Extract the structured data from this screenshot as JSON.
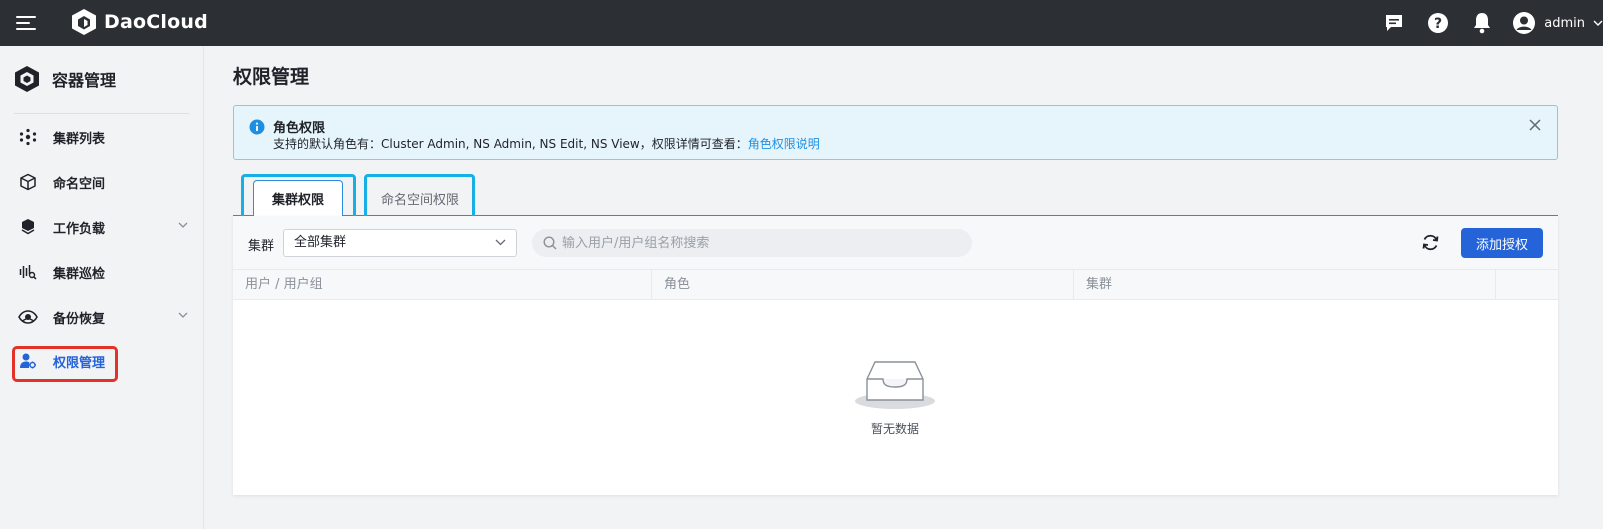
{
  "app": {
    "brand": "DaoCloud"
  },
  "topbar": {
    "user_name": "admin",
    "icons": [
      "message-icon",
      "help-icon",
      "bell-icon",
      "user-avatar-icon"
    ]
  },
  "sidebar": {
    "title": "容器管理",
    "items": [
      {
        "label": "集群列表",
        "icon": "cluster-icon"
      },
      {
        "label": "命名空间",
        "icon": "namespace-icon"
      },
      {
        "label": "工作负载",
        "icon": "workload-icon",
        "expandable": true
      },
      {
        "label": "集群巡检",
        "icon": "inspection-icon"
      },
      {
        "label": "备份恢复",
        "icon": "backup-icon",
        "expandable": true
      },
      {
        "label": "权限管理",
        "icon": "permission-icon",
        "active": true
      }
    ]
  },
  "page": {
    "title": "权限管理"
  },
  "alert": {
    "title": "角色权限",
    "description": "支持的默认角色有：Cluster Admin, NS Admin, NS Edit, NS View，权限详情可查看：",
    "link": "角色权限说明"
  },
  "tabs": [
    {
      "label": "集群权限",
      "active": true
    },
    {
      "label": "命名空间权限",
      "active": false
    }
  ],
  "filter": {
    "cluster_label": "集群",
    "cluster_value": "全部集群",
    "search_placeholder": "输入用户/用户组名称搜索",
    "add_button": "添加授权"
  },
  "table": {
    "columns": [
      "用户 / 用户组",
      "角色",
      "集群",
      ""
    ],
    "rows": [],
    "empty_text": "暂无数据"
  },
  "colors": {
    "accent": "#2563d8",
    "topbar": "#2c2f33",
    "highlight_red": "#e53228",
    "highlight_cyan": "#17b0e6"
  }
}
